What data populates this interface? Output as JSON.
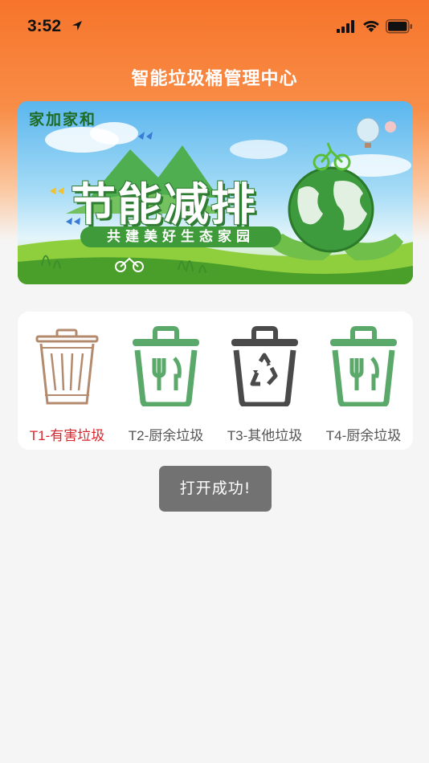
{
  "status_bar": {
    "time": "3:52",
    "icons": [
      "location-arrow-icon",
      "cellular-signal-icon",
      "wifi-icon",
      "battery-icon"
    ]
  },
  "nav": {
    "title": "智能垃圾桶管理中心"
  },
  "banner": {
    "brand": "家加家和",
    "title": "节能减排",
    "subtitle": "共建美好生态家园"
  },
  "bins": [
    {
      "label": "T1-有害垃圾",
      "icon": "hazardous-bin-icon",
      "selected": true
    },
    {
      "label": "T2-厨余垃圾",
      "icon": "kitchen-waste-bin-icon",
      "selected": false
    },
    {
      "label": "T3-其他垃圾",
      "icon": "other-waste-bin-icon",
      "selected": false
    },
    {
      "label": "T4-厨余垃圾",
      "icon": "kitchen-waste-bin-icon",
      "selected": false
    }
  ],
  "toast": {
    "message": "打开成功!"
  },
  "colors": {
    "header_orange": "#f7742b",
    "bin_green": "#5aa86a",
    "bin_gray": "#4a4a4a",
    "bin_brown": "#b48a6e",
    "selected_red": "#d8262c",
    "toast_gray": "#727272"
  }
}
